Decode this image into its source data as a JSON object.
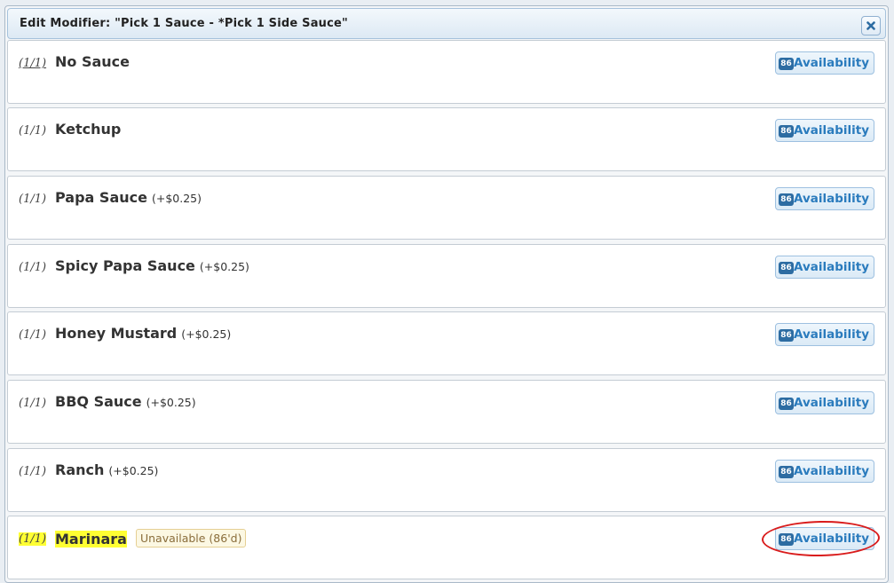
{
  "dialog": {
    "title": "Edit Modifier: \"Pick 1 Sauce - *Pick 1 Side Sauce\"",
    "close_icon": "close-icon"
  },
  "items": [
    {
      "count": "(1/1)",
      "name": "No Sauce",
      "price": "",
      "status": "",
      "chip": "86",
      "button": "Availability"
    },
    {
      "count": "(1/1)",
      "name": "Ketchup",
      "price": "",
      "status": "",
      "chip": "86",
      "button": "Availability"
    },
    {
      "count": "(1/1)",
      "name": "Papa Sauce",
      "price": "(+$0.25)",
      "status": "",
      "chip": "86",
      "button": "Availability"
    },
    {
      "count": "(1/1)",
      "name": "Spicy Papa Sauce",
      "price": "(+$0.25)",
      "status": "",
      "chip": "86",
      "button": "Availability"
    },
    {
      "count": "(1/1)",
      "name": "Honey Mustard",
      "price": "(+$0.25)",
      "status": "",
      "chip": "86",
      "button": "Availability"
    },
    {
      "count": "(1/1)",
      "name": "BBQ Sauce",
      "price": "(+$0.25)",
      "status": "",
      "chip": "86",
      "button": "Availability"
    },
    {
      "count": "(1/1)",
      "name": "Ranch",
      "price": "(+$0.25)",
      "status": "",
      "chip": "86",
      "button": "Availability"
    },
    {
      "count": "(1/1)",
      "name": "Marinara",
      "price": "",
      "status": "Unavailable (86'd)",
      "chip": "86",
      "button": "Availability",
      "highlighted": true
    }
  ],
  "colors": {
    "highlight": "#ffff33",
    "annotation_circle": "#d91c1c",
    "button_text": "#2a7bbd",
    "chip_bg": "#2d6ca2"
  }
}
